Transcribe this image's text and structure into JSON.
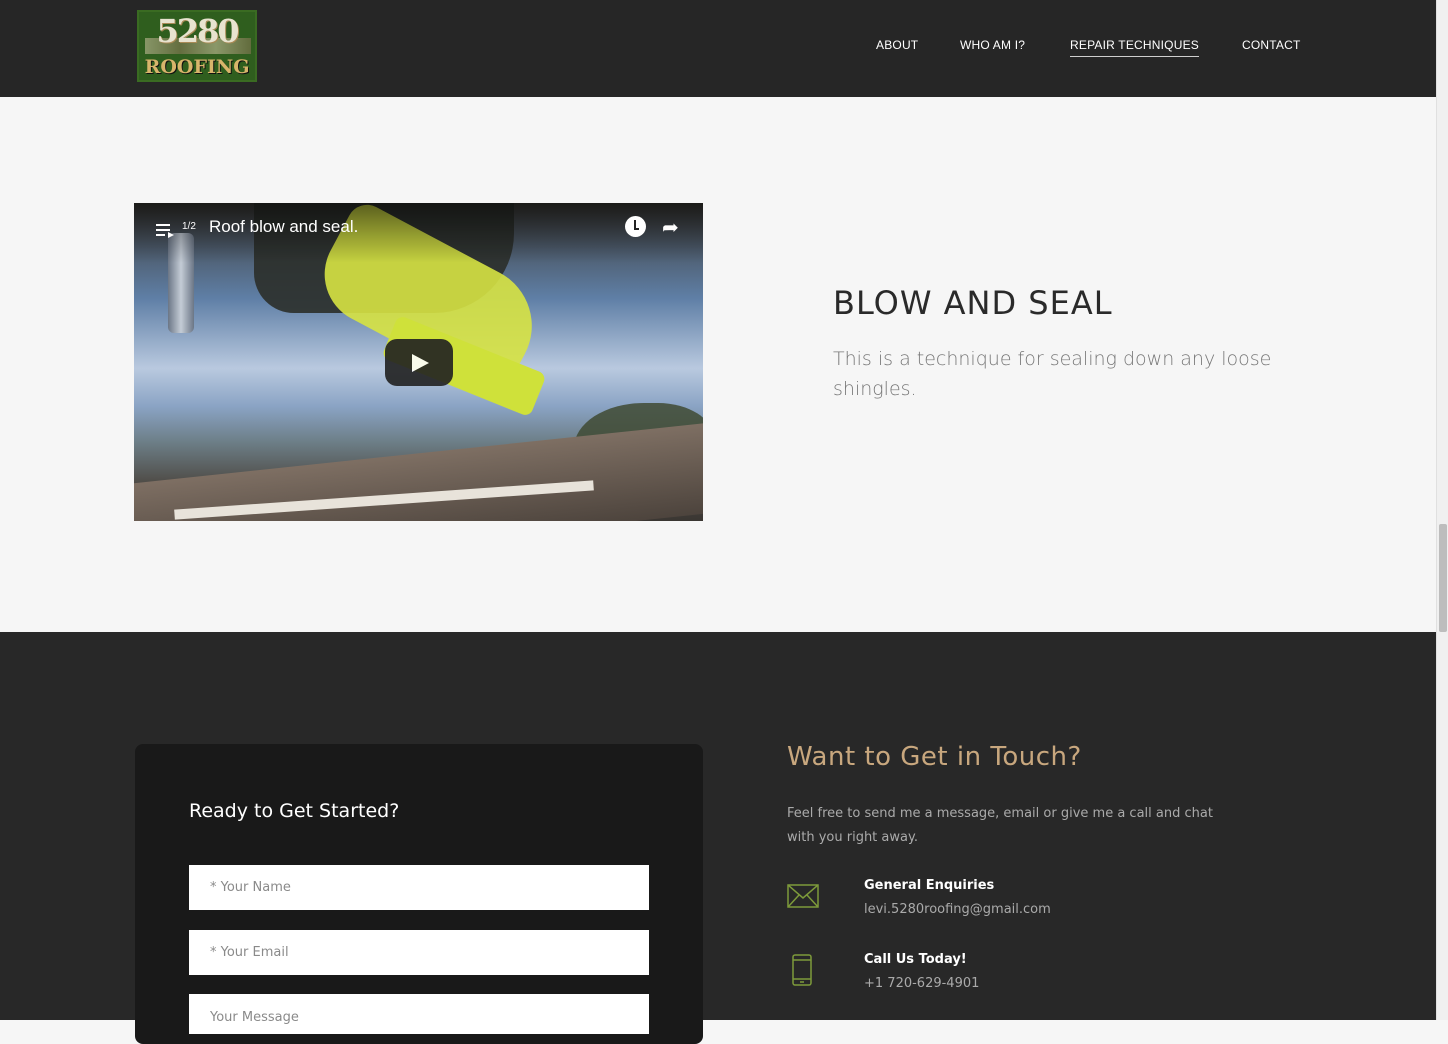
{
  "header": {
    "logo": {
      "number": "5280",
      "word": "ROOFING"
    },
    "nav": [
      {
        "label": "ABOUT",
        "active": false
      },
      {
        "label": "WHO AM I?",
        "active": false
      },
      {
        "label": "REPAIR TECHNIQUES",
        "active": true
      },
      {
        "label": "CONTACT",
        "active": false
      }
    ]
  },
  "technique": {
    "video": {
      "playlist_position": "1/2",
      "title": "Roof blow and seal.",
      "icons": [
        "playlist-icon",
        "watch-later-icon",
        "share-icon",
        "play-icon"
      ]
    },
    "title": "BLOW AND SEAL",
    "description": "This is a technique for sealing down any loose shingles."
  },
  "contact": {
    "form": {
      "title": "Ready to Get Started?",
      "name_placeholder": "* Your Name",
      "email_placeholder": "* Your Email",
      "message_placeholder": "Your Message"
    },
    "info": {
      "title": "Want to Get in Touch?",
      "description": "Feel free to send me a message, email or give me a call and chat with you right away.",
      "email_label": "General Enquiries",
      "email_value": "levi.5280roofing@gmail.com",
      "phone_label": "Call Us Today!",
      "phone_value": "+1 720-629-4901"
    }
  },
  "colors": {
    "header_bg": "#262626",
    "section_bg": "#f6f6f6",
    "contact_bg": "#282828",
    "accent_gold": "#c8a77e",
    "accent_green": "#7d9a3a"
  }
}
